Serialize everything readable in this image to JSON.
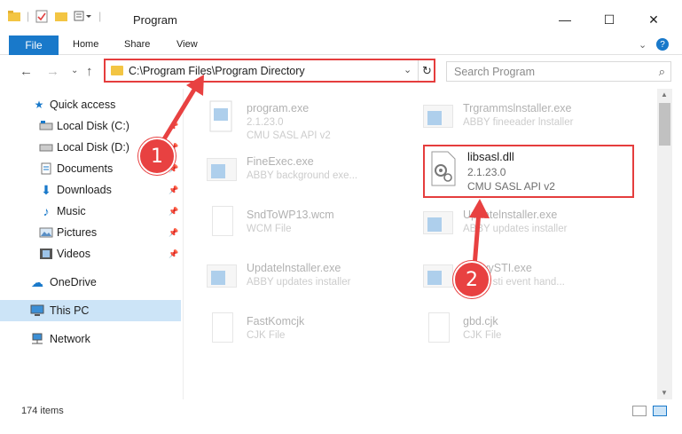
{
  "window": {
    "title": "Program",
    "minimize_label": "—",
    "maximize_label": "☐",
    "close_label": "✕"
  },
  "ribbon": {
    "tabs": [
      "File",
      "Home",
      "Share",
      "View"
    ],
    "expand_label": "⌄",
    "help_label": "?"
  },
  "nav": {
    "back_label": "←",
    "forward_label": "→",
    "recent_label": "⌄",
    "up_label": "↑",
    "address": "C:\\Program Files\\Program Directory",
    "dropdown_label": "⌄",
    "refresh_label": "↻",
    "search_placeholder": "Search Program",
    "search_icon": "⌕"
  },
  "sidebar": {
    "items": [
      {
        "label": "Quick access",
        "icon": "star-icon"
      },
      {
        "label": "Local Disk (C:)",
        "icon": "drive-icon"
      },
      {
        "label": "Local Disk (D:)",
        "icon": "drive-icon"
      },
      {
        "label": "Documents",
        "icon": "documents-icon"
      },
      {
        "label": "Downloads",
        "icon": "download-icon"
      },
      {
        "label": "Music",
        "icon": "music-icon"
      },
      {
        "label": "Pictures",
        "icon": "pictures-icon"
      },
      {
        "label": "Videos",
        "icon": "videos-icon"
      },
      {
        "label": "OneDrive",
        "icon": "cloud-icon"
      },
      {
        "label": "This PC",
        "icon": "computer-icon"
      },
      {
        "label": "Network",
        "icon": "network-icon"
      }
    ]
  },
  "files": [
    {
      "name": "program.exe",
      "line2": "2.1.23.0",
      "line3": "CMU SASL API v2",
      "kind": "exe"
    },
    {
      "name": "Trgrammslnstaller.exe",
      "line2": "ABBY fineeader lnstaller",
      "line3": "",
      "kind": "exe"
    },
    {
      "name": "FineExec.exe",
      "line2": "ABBY background exe...",
      "line3": "",
      "kind": "exe"
    },
    {
      "name": "SndToWP13.wcm",
      "line2": "WCM File",
      "line3": "",
      "kind": "doc"
    },
    {
      "name": "Updatelnstaller.exe",
      "line2": "ABBY updates installer",
      "line3": "",
      "kind": "exe"
    },
    {
      "name": "Updatelnstaller.exe",
      "line2": "ABBY updates installer",
      "line3": "",
      "kind": "exe"
    },
    {
      "name": "AbbyySTI.exe",
      "line2": "ABBY sti event hand...",
      "line3": "",
      "kind": "exe"
    },
    {
      "name": "FastKomcjk",
      "line2": "CJK File",
      "line3": "",
      "kind": "doc"
    },
    {
      "name": "gbd.cjk",
      "line2": "CJK File",
      "line3": "",
      "kind": "doc"
    }
  ],
  "highlighted_file": {
    "name": "libsasl.dll",
    "version": "2.1.23.0",
    "description": "CMU SASL API v2"
  },
  "status": {
    "item_count": "174 items"
  },
  "badges": {
    "one": "1",
    "two": "2"
  },
  "colors": {
    "accent": "#1979ca",
    "highlight_red": "#e53d3d",
    "selected_bg": "#cce4f7"
  }
}
